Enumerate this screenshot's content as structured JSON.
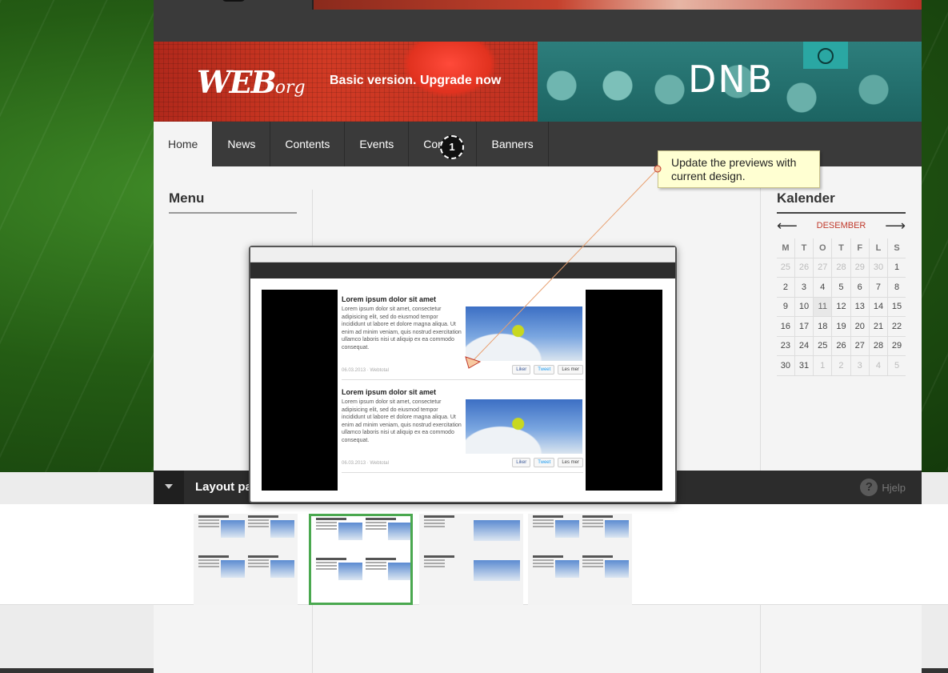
{
  "banner": {
    "logo_main": "WEB",
    "logo_small": "org",
    "upgrade_text": "Basic version. Upgrade now",
    "sponsor": "DNB"
  },
  "nav": {
    "items": [
      {
        "label": "Home",
        "active": true
      },
      {
        "label": "News"
      },
      {
        "label": "Contents"
      },
      {
        "label": "Events"
      },
      {
        "label": "Contact"
      },
      {
        "label": "Banners"
      }
    ]
  },
  "step_badge": "1",
  "tooltip": {
    "text": "Update the previews with current design."
  },
  "sidebar": {
    "menu_title": "Menu"
  },
  "calendar": {
    "title": "Kalender",
    "prev": "⟵",
    "next": "⟶",
    "month": "DESEMBER",
    "weekdays": [
      "M",
      "T",
      "O",
      "T",
      "F",
      "L",
      "S"
    ],
    "weeks": [
      [
        {
          "d": "25",
          "m": 1
        },
        {
          "d": "26",
          "m": 1
        },
        {
          "d": "27",
          "m": 1
        },
        {
          "d": "28",
          "m": 1
        },
        {
          "d": "29",
          "m": 1
        },
        {
          "d": "30",
          "m": 1
        },
        {
          "d": "1"
        }
      ],
      [
        {
          "d": "2"
        },
        {
          "d": "3"
        },
        {
          "d": "4"
        },
        {
          "d": "5"
        },
        {
          "d": "6"
        },
        {
          "d": "7"
        },
        {
          "d": "8"
        }
      ],
      [
        {
          "d": "9"
        },
        {
          "d": "10"
        },
        {
          "d": "11",
          "today": 1
        },
        {
          "d": "12"
        },
        {
          "d": "13"
        },
        {
          "d": "14"
        },
        {
          "d": "15"
        }
      ],
      [
        {
          "d": "16"
        },
        {
          "d": "17"
        },
        {
          "d": "18"
        },
        {
          "d": "19"
        },
        {
          "d": "20"
        },
        {
          "d": "21"
        },
        {
          "d": "22"
        }
      ],
      [
        {
          "d": "23"
        },
        {
          "d": "24"
        },
        {
          "d": "25"
        },
        {
          "d": "26"
        },
        {
          "d": "27"
        },
        {
          "d": "28"
        },
        {
          "d": "29"
        }
      ],
      [
        {
          "d": "30"
        },
        {
          "d": "31"
        },
        {
          "d": "1",
          "m": 1
        },
        {
          "d": "2",
          "m": 1
        },
        {
          "d": "3",
          "m": 1
        },
        {
          "d": "4",
          "m": 1
        },
        {
          "d": "5",
          "m": 1
        }
      ]
    ]
  },
  "preview": {
    "articles": [
      {
        "title": "Lorem ipsum dolor sit amet",
        "body": "Lorem ipsum dolor sit amet, consectetur adipisicing elit, sed do eiusmod tempor incididunt ut labore et dolore magna aliqua. Ut enim ad minim veniam, quis nostrud exercitation ullamco laboris nisi ut aliquip ex ea commodo consequat.",
        "date": "06.03.2013 · Webtotal",
        "like": "Liker",
        "tweet": "Tweet",
        "more": "Les mer"
      },
      {
        "title": "Lorem ipsum dolor sit amet",
        "body": "Lorem ipsum dolor sit amet, consectetur adipisicing elit, sed do eiusmod tempor incididunt ut labore et dolore magna aliqua. Ut enim ad minim veniam, quis nostrud exercitation ullamco laboris nisi ut aliquip ex ea commodo consequat.",
        "date": "06.03.2013 · Webtotal",
        "like": "Liker",
        "tweet": "Tweet",
        "more": "Les mer"
      }
    ]
  },
  "layout_bar": {
    "title": "Layout pa",
    "help": "Hjelp"
  },
  "thumb_text": "Lorem ipsum dolor sit amet",
  "colors": {
    "accent_red": "#c0392b",
    "selected_green": "#4aa84f",
    "tooltip_bg": "#ffffd2"
  }
}
